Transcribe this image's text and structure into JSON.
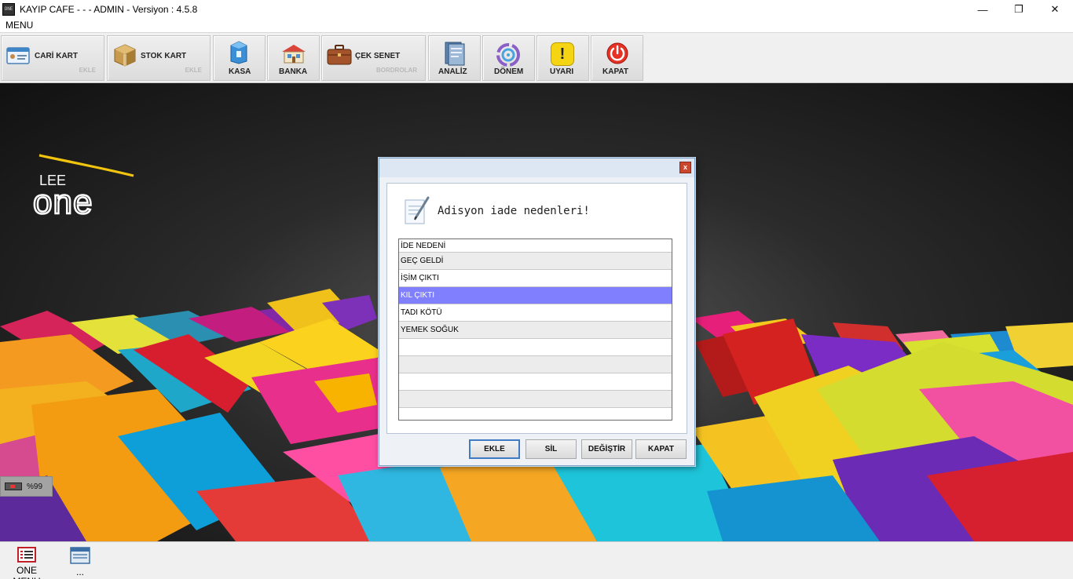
{
  "window": {
    "title": "KAYIP CAFE -  -  - ADMIN -  Versiyon : 4.5.8",
    "icon_text": "ONE",
    "controls": {
      "minimize": "—",
      "maximize": "❐",
      "close": "✕"
    }
  },
  "menubar": {
    "menu_label": "MENU"
  },
  "toolbar": {
    "cari_kart": {
      "label": "CARİ KART",
      "sub": "EKLE"
    },
    "stok_kart": {
      "label": "STOK KART",
      "sub": "EKLE"
    },
    "kasa": {
      "label": "KASA"
    },
    "banka": {
      "label": "BANKA"
    },
    "cek_senet": {
      "label": "ÇEK SENET",
      "sub": "BORDROLAR"
    },
    "analiz": {
      "label": "ANALİZ"
    },
    "donem": {
      "label": "DÖNEM"
    },
    "uyari": {
      "label": "UYARI",
      "glyph": "!"
    },
    "kapat": {
      "label": "KAPAT"
    }
  },
  "logo": {
    "line1": "LEE",
    "line2": "one"
  },
  "status": {
    "battery_text": "%99"
  },
  "taskbar": {
    "items": [
      {
        "label": "ONE MENU"
      },
      {
        "label": "..."
      }
    ]
  },
  "dialog": {
    "close_label": "x",
    "heading": "Adisyon iade nedenleri!",
    "list": {
      "header": "İDE NEDENİ",
      "rows": [
        "GEÇ GELDİ",
        "İŞİM ÇIKTI",
        "KIL ÇIKTI",
        "TADI KÖTÜ",
        "YEMEK SOĞUK",
        "",
        "",
        "",
        "",
        ""
      ],
      "selected_index": 2
    },
    "buttons": {
      "add": "EKLE",
      "delete": "SİL",
      "change": "DEĞİŞTİR",
      "close": "KAPAT"
    }
  },
  "colors": {
    "selection": "#8080ff",
    "dialog_border": "#7ea1c6",
    "button_focus": "#3e7bc4"
  },
  "icons": {
    "cari_kart": "id-card-icon",
    "stok_kart": "box-icon",
    "kasa": "cash-register-icon",
    "banka": "bank-icon",
    "cek_senet": "briefcase-icon",
    "analiz": "analysis-book-icon",
    "donem": "period-cycle-icon",
    "uyari": "warning-icon",
    "kapat": "power-icon"
  }
}
